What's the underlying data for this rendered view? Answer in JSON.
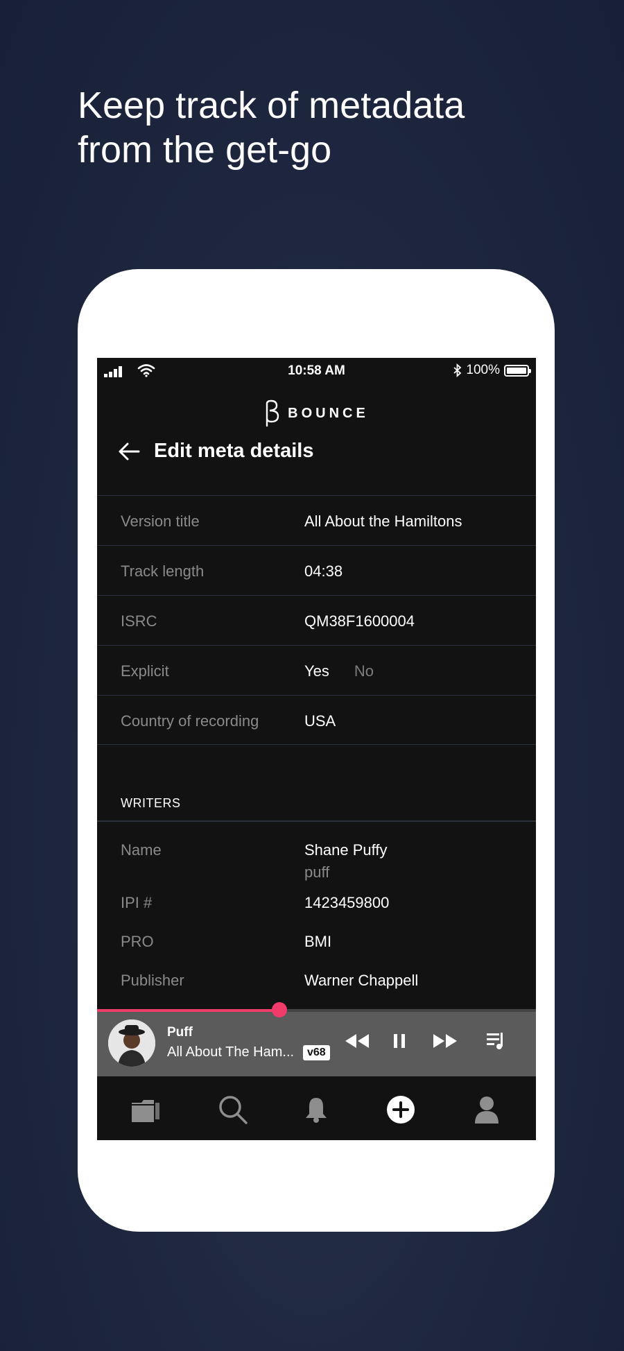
{
  "headline": {
    "line1": "Keep track of metadata",
    "line2": "from the get-go"
  },
  "status_bar": {
    "time": "10:58 AM",
    "battery": "100%"
  },
  "app": {
    "logo_text": "BOUNCE"
  },
  "header": {
    "title": "Edit meta details"
  },
  "fields": [
    {
      "label": "Version title",
      "value": "All About the Hamiltons"
    },
    {
      "label": "Track length",
      "value": "04:38"
    },
    {
      "label": "ISRC",
      "value": "QM38F1600004"
    },
    {
      "label": "Explicit",
      "options": [
        "Yes",
        "No"
      ],
      "selected": "Yes"
    },
    {
      "label": "Country of recording",
      "value": "USA"
    }
  ],
  "writers": {
    "section_title": "WRITERS",
    "name_label": "Name",
    "name_value": "Shane Puffy",
    "name_sub": "puff",
    "ipi_label": "IPI #",
    "ipi_value": "1423459800",
    "pro_label": "PRO",
    "pro_value": "BMI",
    "publisher_label": "Publisher",
    "publisher_value": "Warner Chappell"
  },
  "player": {
    "artist": "Puff",
    "title": "All About The Ham...",
    "version_badge": "v68",
    "progress": 0.415,
    "state": "playing"
  },
  "nav": {
    "items": [
      "folder-icon",
      "search-icon",
      "bell-icon",
      "add-icon",
      "profile-icon"
    ]
  },
  "colors": {
    "background": "#1f2840",
    "screen": "#121212",
    "accent": "#ef3c6a",
    "player_bar": "#5b5b5b"
  }
}
